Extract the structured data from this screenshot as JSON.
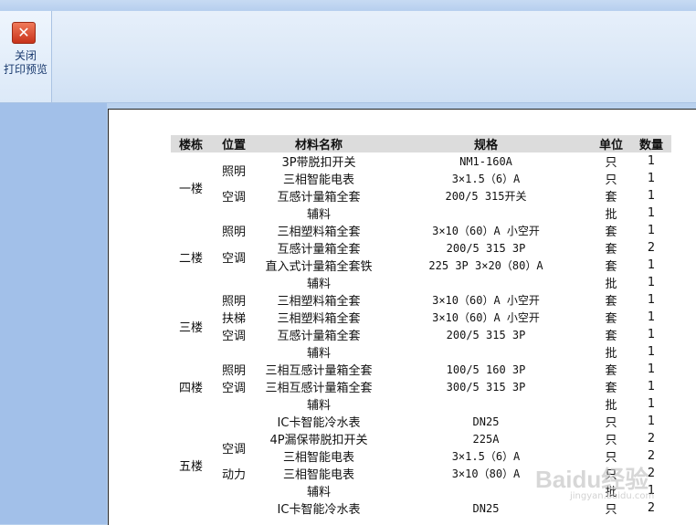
{
  "toolbar": {
    "close_label": "关闭\n打印预览",
    "close_line1": "关闭",
    "close_line2": "打印预览",
    "close_icon": "close-icon"
  },
  "table": {
    "headers": [
      "楼栋",
      "位置",
      "材料名称",
      "规格",
      "单位",
      "数量"
    ],
    "rows": [
      {
        "floor": "一楼",
        "loc": "照明",
        "name": "3P带脱扣开关",
        "spec": "NM1-160A",
        "unit": "只",
        "qty": "1"
      },
      {
        "floor": "",
        "loc": "",
        "name": "三相智能电表",
        "spec": "3×1.5（6）A",
        "unit": "只",
        "qty": "1"
      },
      {
        "floor": "",
        "loc": "空调",
        "name": "互感计量箱全套",
        "spec": "200/5 315开关",
        "unit": "套",
        "qty": "1"
      },
      {
        "floor": "",
        "loc": "",
        "name": "辅料",
        "spec": "",
        "unit": "批",
        "qty": "1"
      },
      {
        "floor": "二楼",
        "loc": "照明",
        "name": "三相塑料箱全套",
        "spec": "3×10（60）A 小空开",
        "unit": "套",
        "qty": "1"
      },
      {
        "floor": "",
        "loc": "空调",
        "name": "互感计量箱全套",
        "spec": "200/5 315 3P",
        "unit": "套",
        "qty": "2"
      },
      {
        "floor": "",
        "loc": "",
        "name": "直入式计量箱全套铁",
        "spec": "225 3P 3×20（80）A",
        "unit": "套",
        "qty": "1"
      },
      {
        "floor": "",
        "loc": "",
        "name": "辅料",
        "spec": "",
        "unit": "批",
        "qty": "1"
      },
      {
        "floor": "三楼",
        "loc": "照明",
        "name": "三相塑料箱全套",
        "spec": "3×10（60）A 小空开",
        "unit": "套",
        "qty": "1"
      },
      {
        "floor": "",
        "loc": "扶梯",
        "name": "三相塑料箱全套",
        "spec": "3×10（60）A 小空开",
        "unit": "套",
        "qty": "1"
      },
      {
        "floor": "",
        "loc": "空调",
        "name": "互感计量箱全套",
        "spec": "200/5 315 3P",
        "unit": "套",
        "qty": "1"
      },
      {
        "floor": "",
        "loc": "",
        "name": "辅料",
        "spec": "",
        "unit": "批",
        "qty": "1"
      },
      {
        "floor": "四楼",
        "loc": "照明",
        "name": "三相互感计量箱全套",
        "spec": "100/5 160 3P",
        "unit": "套",
        "qty": "1"
      },
      {
        "floor": "",
        "loc": "空调",
        "name": "三相互感计量箱全套",
        "spec": "300/5 315 3P",
        "unit": "套",
        "qty": "1"
      },
      {
        "floor": "",
        "loc": "",
        "name": "辅料",
        "spec": "",
        "unit": "批",
        "qty": "1"
      },
      {
        "floor": "五楼",
        "loc": "",
        "name": "IC卡智能冷水表",
        "spec": "DN25",
        "unit": "只",
        "qty": "1"
      },
      {
        "floor": "",
        "loc": "空调",
        "name": "4P漏保带脱扣开关",
        "spec": "225A",
        "unit": "只",
        "qty": "2"
      },
      {
        "floor": "",
        "loc": "",
        "name": "三相智能电表",
        "spec": "3×1.5（6）A",
        "unit": "只",
        "qty": "2"
      },
      {
        "floor": "",
        "loc": "动力",
        "name": "三相智能电表",
        "spec": "3×10（80）A",
        "unit": "只",
        "qty": "2"
      },
      {
        "floor": "",
        "loc": "",
        "name": "辅料",
        "spec": "",
        "unit": "批",
        "qty": "1"
      },
      {
        "floor": "",
        "loc": "",
        "name": "IC卡智能冷水表",
        "spec": "DN25",
        "unit": "只",
        "qty": "2"
      }
    ]
  },
  "watermark": {
    "text": "Baidu经验",
    "sub": "jingyan.baidu.com"
  }
}
